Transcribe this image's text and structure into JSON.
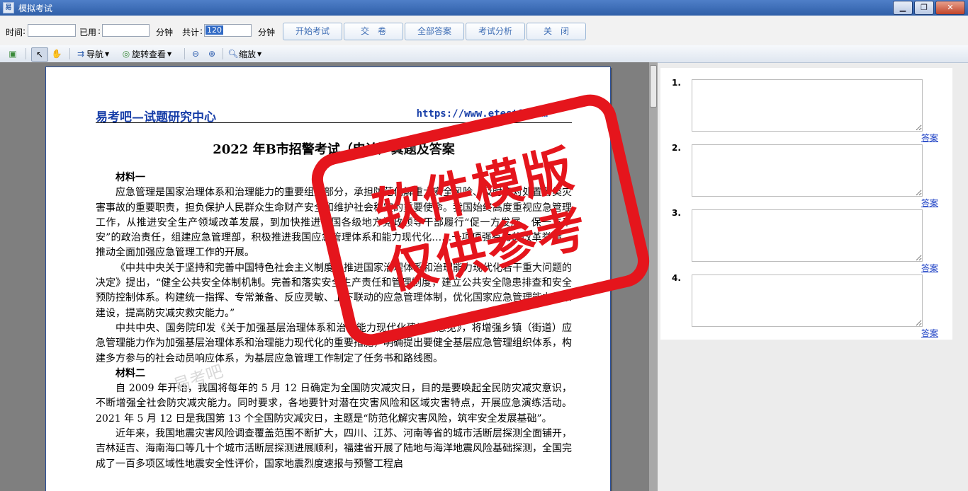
{
  "window": {
    "title": "模拟考试",
    "app_icon_text": "易",
    "minimize_icon": "minimize-icon",
    "maximize_icon": "maximize-icon",
    "close_icon": "close-icon"
  },
  "controls": {
    "time_label": "时间",
    "time_value": "",
    "used_label": "已用",
    "used_value": "",
    "minutes_label_1": "分钟",
    "total_label": "共计",
    "total_value": "120",
    "minutes_label_2": "分钟",
    "buttons": {
      "start": "开始考试",
      "submit": "交　卷",
      "all_answers": "全部答案",
      "analysis": "考试分析",
      "close": "关　闭"
    }
  },
  "viewer_toolbar": {
    "nav_label": "导航",
    "rotate_label": "旋转查看",
    "zoom_label": "缩放",
    "icons": [
      "save-icon",
      "select-arrow-icon",
      "hand-icon",
      "nav-icon",
      "rotate-icon",
      "zoom-out-icon",
      "zoom-in-icon",
      "zoom-icon"
    ]
  },
  "document": {
    "header_left": "易考吧—试题研究中心",
    "header_right": "https://www.etest8.com",
    "title": "2022 年B市招警考试（申论）真题及答案",
    "watermark_text": "易考吧",
    "sections": [
      {
        "heading": "材料一"
      },
      {
        "text": "应急管理是国家治理体系和治理能力的重要组成部分，承担防范化解重大安全风险、及时应对处置各类灾害事故的重要职责，担负保护人民群众生命财产安全和维护社会稳定的重要使命。我国始终高度重视应急管理工作，从推进安全生产领域改革发展，到加快推进全国各级地方党政领导干部履行“促一方发展、保一方平安”的政治责任，组建应急管理部，积极推进我国应急管理体系和能力现代化……一项项强有力的改革举措，推动全面加强应急管理工作的开展。"
      },
      {
        "text": "《中共中央关于坚持和完善中国特色社会主义制度、推进国家治理体系和治理能力现代化若干重大问题的决定》提出，“健全公共安全体制机制。完善和落实安全生产责任和管理制度，建立公共安全隐患排查和安全预防控制体系。构建统一指挥、专常兼备、反应灵敏、上下联动的应急管理体制，优化国家应急管理能力体系建设，提高防灾减灾救灾能力。”"
      },
      {
        "text": "中共中央、国务院印发《关于加强基层治理体系和治理能力现代化建设的意见》，将增强乡镇（街道）应急管理能力作为加强基层治理体系和治理能力现代化的重要措施，明确提出要健全基层应急管理组织体系，构建多方参与的社会动员响应体系，为基层应急管理工作制定了任务书和路线图。"
      },
      {
        "heading": "材料二"
      },
      {
        "text": "自 2009 年开始，我国将每年的 5 月 12 日确定为全国防灾减灾日，目的是要唤起全民防灾减灾意识，不断增强全社会防灾减灾能力。同时要求，各地要针对潜在灾害风险和区域灾害特点，开展应急演练活动。2021 年 5 月 12 日是我国第 13 个全国防灾减灾日，主题是“防范化解灾害风险，筑牢安全发展基础”。"
      },
      {
        "text": "近年来，我国地震灾害风险调查覆盖范围不断扩大，四川、江苏、河南等省的城市活断层探测全面铺开，吉林延吉、海南海口等几十个城市活断层探测进展顺利，福建省开展了陆地与海洋地震风险基础探测，全国完成了一百多项区域性地震安全性评价，国家地震烈度速报与预警工程启"
      }
    ]
  },
  "stamp": {
    "line1": "软件模版",
    "line2": "仅供参考"
  },
  "answers": {
    "link_label": "答案",
    "questions": [
      {
        "number": "1."
      },
      {
        "number": "2."
      },
      {
        "number": "3."
      },
      {
        "number": "4."
      }
    ]
  }
}
